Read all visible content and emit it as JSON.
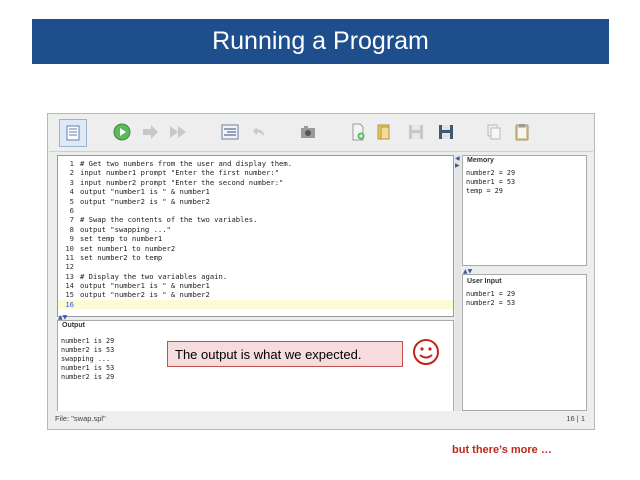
{
  "slide": {
    "title": "Running a Program",
    "callout": "The output is what we expected.",
    "footer_note": "but there’s more …",
    "smiley_icon": "smiley-face-icon"
  },
  "toolbar": {
    "icons": [
      "list-view-icon",
      "run-icon",
      "step-icon",
      "fast-forward-icon",
      "indent-icon",
      "undo-icon",
      "camera-icon",
      "new-file-icon",
      "open-file-icon",
      "save-icon",
      "save-as-icon",
      "copy-icon",
      "clipboard-icon"
    ]
  },
  "editor": {
    "lines": [
      {
        "n": "1",
        "text": "# Get two numbers from the user and display them."
      },
      {
        "n": "2",
        "text": "input number1 prompt \"Enter the first number:\""
      },
      {
        "n": "3",
        "text": "input number2 prompt \"Enter the second number:\""
      },
      {
        "n": "4",
        "text": "output \"number1 is \" & number1"
      },
      {
        "n": "5",
        "text": "output \"number2 is \" & number2"
      },
      {
        "n": "6",
        "text": ""
      },
      {
        "n": "7",
        "text": "# Swap the contents of the two variables."
      },
      {
        "n": "8",
        "text": "output \"swapping ...\""
      },
      {
        "n": "9",
        "text": "set temp to number1"
      },
      {
        "n": "10",
        "text": "set number1 to number2"
      },
      {
        "n": "11",
        "text": "set number2 to temp"
      },
      {
        "n": "12",
        "text": ""
      },
      {
        "n": "13",
        "text": "# Display the two variables again."
      },
      {
        "n": "14",
        "text": "output \"number1 is \" & number1"
      },
      {
        "n": "15",
        "text": "output \"number2 is \" & number2"
      },
      {
        "n": "16",
        "text": ""
      }
    ]
  },
  "output_panel": {
    "title": "Output",
    "text": "number1 is 29\nnumber2 is 53\nswapping ...\nnumber1 is 53\nnumber2 is 29"
  },
  "memory_panel": {
    "title": "Memory",
    "text": "number2 = 29\nnumber1 = 53\ntemp = 29"
  },
  "user_input_panel": {
    "title": "User Input",
    "text": "number1 = 29\nnumber2 = 53"
  },
  "status": {
    "file": "File: \"swap.spl\"",
    "position": "16 | 1"
  },
  "colors": {
    "title_bar": "#1f4e8c",
    "callout_border": "#c0504d",
    "callout_fill": "#f6dcdc",
    "accent_red": "#c0261a"
  }
}
